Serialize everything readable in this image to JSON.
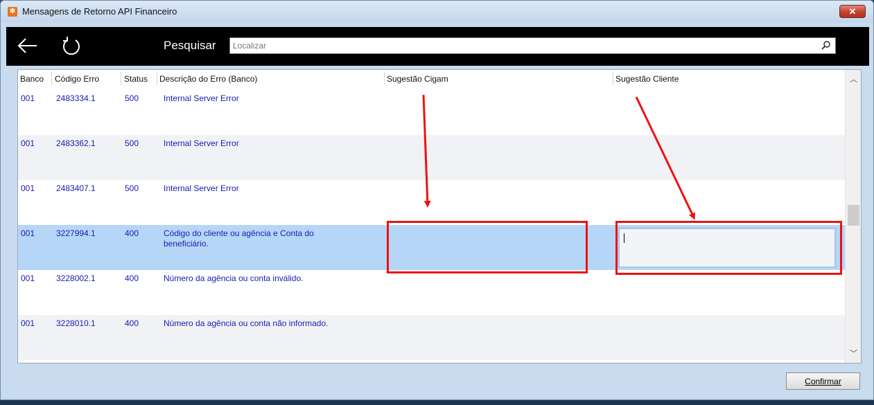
{
  "window": {
    "title": "Mensagens de Retorno API Financeiro",
    "app_icon_glyph": "✻"
  },
  "toolbar": {
    "search_label": "Pesquisar",
    "search_placeholder": "Localizar"
  },
  "grid": {
    "columns": [
      "Banco",
      "Código Erro",
      "Status",
      "Descrição do Erro (Banco)",
      "Sugestão Cigam",
      "Sugestão Cliente"
    ],
    "rows": [
      {
        "banco": "001",
        "codigo": "2483334.1",
        "status": "500",
        "descricao": "Internal Server Error",
        "sugestao_cigam": "",
        "sugestao_cliente": ""
      },
      {
        "banco": "001",
        "codigo": "2483362.1",
        "status": "500",
        "descricao": "Internal Server Error",
        "sugestao_cigam": "",
        "sugestao_cliente": ""
      },
      {
        "banco": "001",
        "codigo": "2483407.1",
        "status": "500",
        "descricao": "Internal Server Error",
        "sugestao_cigam": "",
        "sugestao_cliente": ""
      },
      {
        "banco": "001",
        "codigo": "3227994.1",
        "status": "400",
        "descricao": "Código do cliente ou agência e Conta do beneficiário.",
        "sugestao_cigam": "",
        "sugestao_cliente": ""
      },
      {
        "banco": "001",
        "codigo": "3228002.1",
        "status": "400",
        "descricao": "Número da agência ou conta inválido.",
        "sugestao_cigam": "",
        "sugestao_cliente": ""
      },
      {
        "banco": "001",
        "codigo": "3228010.1",
        "status": "400",
        "descricao": "Número da agência ou conta não informado.",
        "sugestao_cigam": "",
        "sugestao_cliente": ""
      }
    ],
    "selected_row_index": 3
  },
  "footer": {
    "confirm_label": "Confirmar"
  },
  "colors": {
    "toolbar_bg": "#000000",
    "selected_row": "#b6d6f8",
    "cell_text": "#1a1ab0",
    "annotation_red": "#ee1111"
  },
  "icons": [
    "back-arrow-icon",
    "refresh-icon",
    "search-icon",
    "close-icon",
    "scroll-up-icon",
    "scroll-down-icon"
  ]
}
